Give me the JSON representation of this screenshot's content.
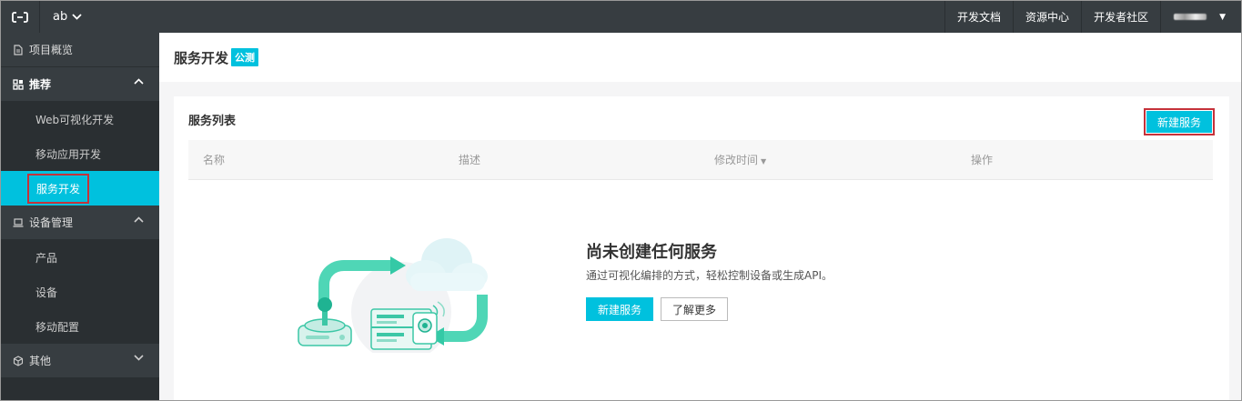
{
  "topbar": {
    "project": "ab",
    "links": [
      "开发文档",
      "资源中心",
      "开发者社区"
    ]
  },
  "sidebar": {
    "groups": [
      {
        "label": "项目概览",
        "icon": "doc-icon"
      },
      {
        "label": "推荐",
        "icon": "grid-icon",
        "expanded": true,
        "items": [
          "Web可视化开发",
          "移动应用开发",
          "服务开发"
        ],
        "active": "服务开发"
      },
      {
        "label": "设备管理",
        "icon": "device-icon",
        "expanded": true,
        "items": [
          "产品",
          "设备",
          "移动配置"
        ]
      },
      {
        "label": "其他",
        "icon": "cube-icon",
        "expanded": false
      }
    ]
  },
  "page": {
    "title": "服务开发",
    "badge": "公测"
  },
  "list": {
    "title": "服务列表",
    "new_button": "新建服务",
    "columns": [
      "名称",
      "描述",
      "修改时间",
      "操作"
    ]
  },
  "empty": {
    "title": "尚未创建任何服务",
    "desc": "通过可视化编排的方式，轻松控制设备或生成API。",
    "primary_button": "新建服务",
    "secondary_button": "了解更多"
  },
  "colors": {
    "accent": "#00c1de",
    "topbar": "#373d41",
    "sidebar": "#2a2f32",
    "highlight": "#c5323a"
  }
}
